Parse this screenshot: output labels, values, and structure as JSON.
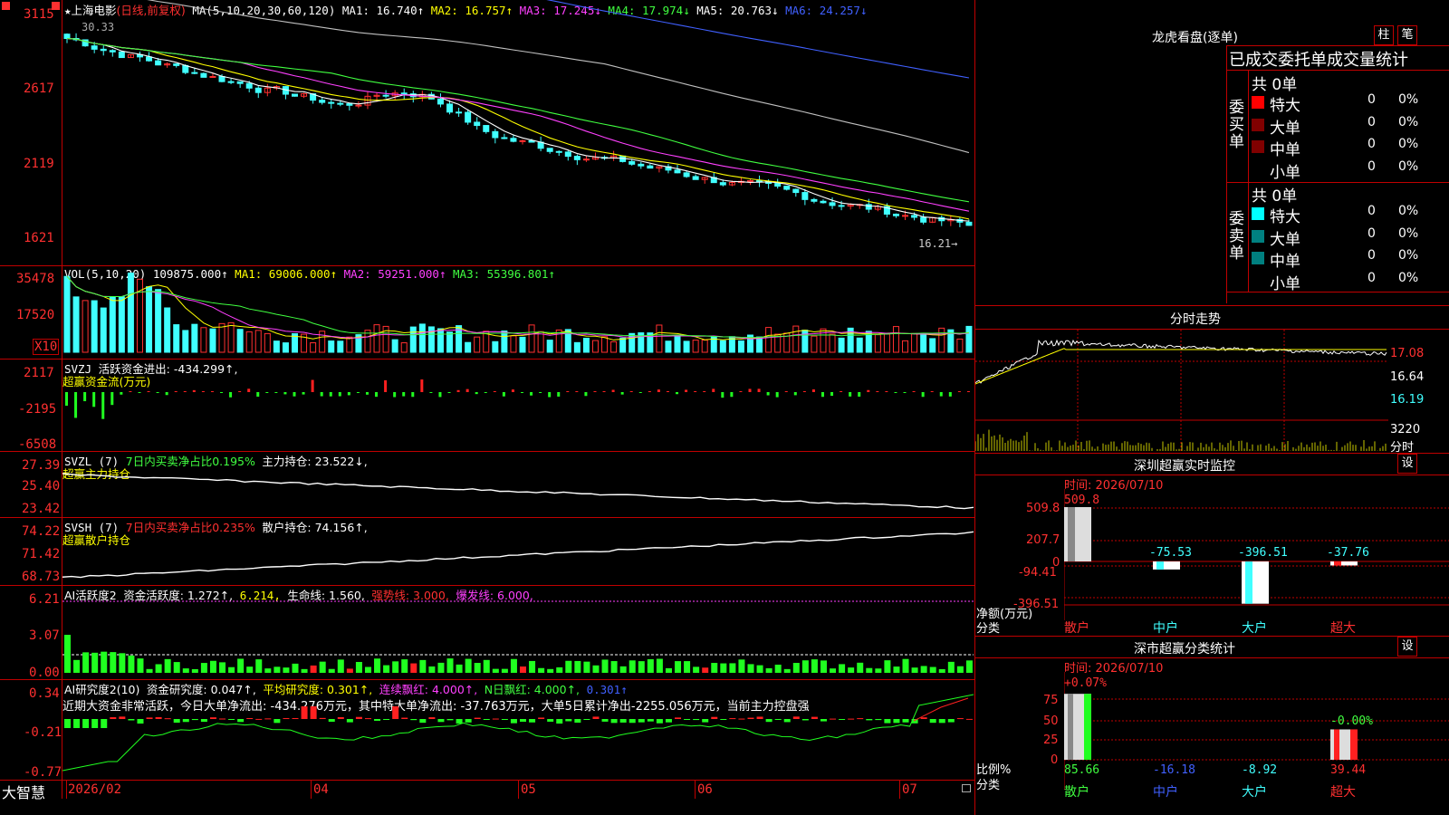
{
  "colors": {
    "up": "#ff3030",
    "down": "#40ffff",
    "grid": "#c00000",
    "ma1": "#ffffff",
    "ma2": "#ffff00",
    "ma3": "#ff40ff",
    "ma4": "#40ff40",
    "ma5": "#c0c0c0",
    "ma6": "#4060ff"
  },
  "main": {
    "star": "★",
    "stock_name": "上海电影",
    "period": "(日线,前复权)",
    "ma_label": "MA(5,10,20,30,60,120)",
    "ma1": "MA1: 16.740↑",
    "ma2": "MA2: 16.757↑",
    "ma3": "MA3: 17.245↓",
    "ma4": "MA4: 17.974↓",
    "ma5": "MA5: 20.763↓",
    "ma6": "MA6: 24.257↓",
    "yticks": [
      "3115",
      "2617",
      "2119",
      "1621"
    ],
    "high_label": "30.33",
    "low_label": "16.21→"
  },
  "vol": {
    "label": "VOL(5,10,20)",
    "value": "109875.000↑",
    "ma1": "MA1: 69006.000↑",
    "ma2": "MA2: 59251.000↑",
    "ma3": "MA3: 55396.801↑",
    "yticks": [
      "35478",
      "17520"
    ],
    "unit": "X10"
  },
  "svzj": {
    "label": "SVZJ",
    "title": "活跃资金进出: -434.299↑,",
    "subtitle": "超赢资金流(万元)",
    "yticks": [
      "2117",
      "-2195",
      "-6508"
    ]
  },
  "svzl": {
    "label": "SVZL (7)",
    "ratio": "7日内买卖净占比0.195%",
    "hold": "主力持仓: 23.522↓,",
    "subtitle": "超赢主力持仓",
    "yticks": [
      "27.39",
      "25.40",
      "23.42"
    ]
  },
  "svsh": {
    "label": "SVSH (7)",
    "ratio": "7日内买卖净占比0.235%",
    "hold": "散户持仓: 74.156↑,",
    "subtitle": "超赢散户持仓",
    "yticks": [
      "74.22",
      "71.42",
      "68.73"
    ]
  },
  "ai1": {
    "label": "AI活跃度2",
    "a": "资金活跃度: 1.272↑,",
    "b": "6.214,",
    "c": "生命线: 1.560,",
    "d": "强势线: 3.000,",
    "e": "爆发线: 6.000,",
    "yticks": [
      "6.21",
      "3.07",
      "0.00"
    ]
  },
  "ai2": {
    "label": "AI研究度2(10)",
    "a": "资金研究度: 0.047↑,",
    "b": "平均研究度: 0.301↑,",
    "c": "连续飘红: 4.000↑,",
    "d": "N日飘红: 4.000↑,",
    "e": "0.301↑",
    "comment": "近期大资金非常活跃，今日大单净流出: -434.276万元，其中特大单净流出: -37.763万元，大单5日累计净出-2255.056万元，当前主力控盘强",
    "yticks": [
      "0.34",
      "-0.21",
      "-0.77"
    ]
  },
  "xaxis": {
    "app": "大智慧",
    "labels": [
      "2026/02",
      "04",
      "05",
      "06",
      "07"
    ]
  },
  "lhb": {
    "title": "龙虎看盘(逐单)",
    "btn_col": "柱",
    "btn_note": "笔",
    "section": "已成交委托单成交量统计",
    "buy": {
      "side": "委买单",
      "total": "共 0单",
      "rows": [
        {
          "name": "特大",
          "n": "0",
          "p": "0%",
          "c": "#ff0000"
        },
        {
          "name": "大单",
          "n": "0",
          "p": "0%",
          "c": "#800000"
        },
        {
          "name": "中单",
          "n": "0",
          "p": "0%",
          "c": "#800000"
        },
        {
          "name": "小单",
          "n": "0",
          "p": "0%",
          "c": "#000000"
        }
      ]
    },
    "sell": {
      "side": "委卖单",
      "total": "共 0单",
      "rows": [
        {
          "name": "特大",
          "n": "0",
          "p": "0%",
          "c": "#00ffff"
        },
        {
          "name": "大单",
          "n": "0",
          "p": "0%",
          "c": "#008080"
        },
        {
          "name": "中单",
          "n": "0",
          "p": "0%",
          "c": "#008080"
        },
        {
          "name": "小单",
          "n": "0",
          "p": "0%",
          "c": "#000000"
        }
      ]
    }
  },
  "intraday": {
    "title": "分时走势",
    "yticks": [
      "17.08",
      "16.64",
      "16.19",
      "3220"
    ],
    "vol_unit": "分时"
  },
  "monitor": {
    "title": "深圳超赢实时监控",
    "settings": "设",
    "time": "时间: 2026/07/10",
    "yticks": [
      "509.8",
      "207.7",
      "0",
      "-94.41",
      "-396.51"
    ],
    "ylabel": "净额(万元)",
    "xlabel": "分类",
    "cats": [
      "散户",
      "中户",
      "大户",
      "超大"
    ],
    "values": [
      "509.8",
      "-75.53",
      "-396.51",
      "-37.76"
    ]
  },
  "classify": {
    "title": "深市超赢分类统计",
    "settings": "设",
    "time": "时间: 2026/07/10",
    "yticks": [
      "75",
      "50",
      "25",
      "0"
    ],
    "ylabel": "比例%",
    "xlabel": "分类",
    "top_labels": [
      "+0.07%",
      "-0.00%"
    ],
    "values": [
      "85.66",
      "-16.18",
      "-8.92",
      "39.44"
    ],
    "cats": [
      "散户",
      "中户",
      "大户",
      "超大"
    ]
  },
  "chart_data": {
    "type": "bar",
    "title": "深圳超赢实时监控",
    "categories": [
      "散户",
      "中户",
      "大户",
      "超大"
    ],
    "values": [
      509.8,
      -75.53,
      -396.51,
      -37.76
    ],
    "ylabel": "净额(万元)"
  }
}
